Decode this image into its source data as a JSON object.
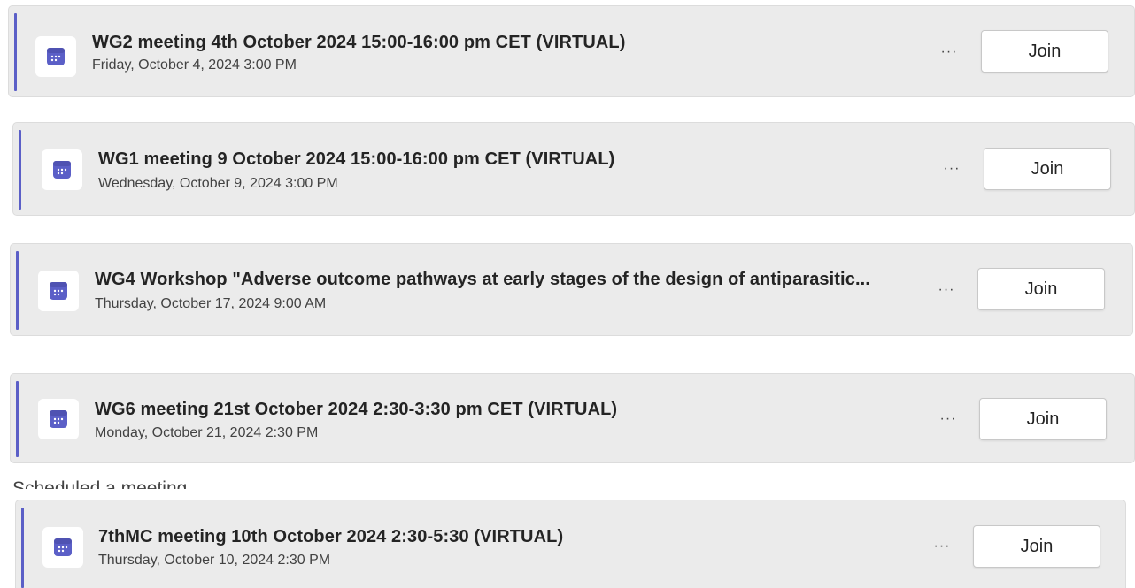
{
  "accent_color": "#5b5fc7",
  "card_background": "#ebebeb",
  "meetings": [
    {
      "title": "WG2 meeting 4th October 2024 15:00-16:00 pm CET (VIRTUAL)",
      "datetime": "Friday, October 4, 2024 3:00 PM",
      "more_label": "···",
      "join_label": "Join",
      "icon": "calendar-icon"
    },
    {
      "title": "WG1 meeting 9 October 2024 15:00-16:00 pm CET (VIRTUAL)",
      "datetime": "Wednesday, October 9, 2024 3:00 PM",
      "more_label": "···",
      "join_label": "Join",
      "icon": "calendar-icon"
    },
    {
      "title": "WG4 Workshop \"Adverse outcome pathways at early stages of the design of antiparasitic...",
      "datetime": "Thursday, October 17, 2024 9:00 AM",
      "more_label": "···",
      "join_label": "Join",
      "icon": "calendar-icon"
    },
    {
      "title": "WG6 meeting 21st October 2024 2:30-3:30 pm CET (VIRTUAL)",
      "datetime": "Monday, October 21, 2024 2:30 PM",
      "more_label": "···",
      "join_label": "Join",
      "icon": "calendar-icon"
    },
    {
      "title": "7thMC meeting 10th October 2024 2:30-5:30 (VIRTUAL)",
      "datetime": "Thursday, October 10, 2024 2:30 PM",
      "more_label": "···",
      "join_label": "Join",
      "icon": "calendar-icon"
    }
  ],
  "system_message": "Scheduled a meeting"
}
